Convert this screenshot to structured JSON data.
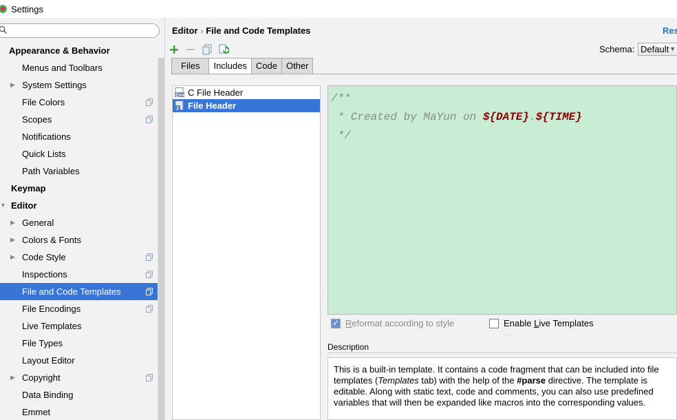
{
  "window": {
    "title": "Settings"
  },
  "search": {
    "value": "",
    "placeholder": ""
  },
  "sidebar": {
    "items": [
      {
        "label": "Appearance & Behavior",
        "level": 0,
        "bold": true,
        "arrow": "",
        "copy": false
      },
      {
        "label": "Menus and Toolbars",
        "level": 1,
        "bold": false,
        "arrow": "",
        "copy": false
      },
      {
        "label": "System Settings",
        "level": 1,
        "bold": false,
        "arrow": "right",
        "copy": false
      },
      {
        "label": "File Colors",
        "level": 1,
        "bold": false,
        "arrow": "",
        "copy": true
      },
      {
        "label": "Scopes",
        "level": 1,
        "bold": false,
        "arrow": "",
        "copy": true
      },
      {
        "label": "Notifications",
        "level": 1,
        "bold": false,
        "arrow": "",
        "copy": false
      },
      {
        "label": "Quick Lists",
        "level": 1,
        "bold": false,
        "arrow": "",
        "copy": false
      },
      {
        "label": "Path Variables",
        "level": 1,
        "bold": false,
        "arrow": "",
        "copy": false
      },
      {
        "label": "Keymap",
        "level": 0,
        "bold": true,
        "arrow": "",
        "copy": false
      },
      {
        "label": "Editor",
        "level": 0,
        "bold": true,
        "arrow": "down",
        "copy": false
      },
      {
        "label": "General",
        "level": 1,
        "bold": false,
        "arrow": "right",
        "copy": false
      },
      {
        "label": "Colors & Fonts",
        "level": 1,
        "bold": false,
        "arrow": "right",
        "copy": false
      },
      {
        "label": "Code Style",
        "level": 1,
        "bold": false,
        "arrow": "right",
        "copy": true
      },
      {
        "label": "Inspections",
        "level": 1,
        "bold": false,
        "arrow": "",
        "copy": true
      },
      {
        "label": "File and Code Templates",
        "level": 1,
        "bold": false,
        "arrow": "",
        "copy": true,
        "selected": true
      },
      {
        "label": "File Encodings",
        "level": 1,
        "bold": false,
        "arrow": "",
        "copy": true
      },
      {
        "label": "Live Templates",
        "level": 1,
        "bold": false,
        "arrow": "",
        "copy": false
      },
      {
        "label": "File Types",
        "level": 1,
        "bold": false,
        "arrow": "",
        "copy": false
      },
      {
        "label": "Layout Editor",
        "level": 1,
        "bold": false,
        "arrow": "",
        "copy": false
      },
      {
        "label": "Copyright",
        "level": 1,
        "bold": false,
        "arrow": "right",
        "copy": true
      },
      {
        "label": "Data Binding",
        "level": 1,
        "bold": false,
        "arrow": "",
        "copy": false
      },
      {
        "label": "Emmet",
        "level": 1,
        "bold": false,
        "arrow": "",
        "copy": false
      }
    ]
  },
  "breadcrumb": {
    "parent": "Editor",
    "separator": "›",
    "current": "File and Code Templates"
  },
  "reset_label": "Res",
  "schema": {
    "label": "Schema:",
    "value": "Default"
  },
  "tabs": [
    {
      "label": "Files",
      "active": false
    },
    {
      "label": "Includes",
      "active": true
    },
    {
      "label": "Code",
      "active": false
    },
    {
      "label": "Other",
      "active": false
    }
  ],
  "templates": [
    {
      "label": "C File Header",
      "icon": "c-file-icon",
      "selected": false
    },
    {
      "label": "File Header",
      "icon": "java-file-icon",
      "selected": true
    }
  ],
  "editor": {
    "line1": "/**",
    "line2_prefix": " * Created by MaYun on ",
    "var_date": "${DATE}",
    "dot": ".",
    "var_time": "${TIME}",
    "line3": " */"
  },
  "options": {
    "reformat": {
      "label_pre": "",
      "label_u": "R",
      "label_post": "eformat according to style",
      "checked": true,
      "enabled": false
    },
    "live": {
      "label_pre": "Enable ",
      "label_u": "L",
      "label_post": "ive Templates",
      "checked": false,
      "enabled": true
    }
  },
  "description": {
    "label": "Description",
    "text_1": "This is a built-in template. It contains a code fragment that can be included into file templates (",
    "text_templates": "Templates",
    "text_2": " tab) with the help of the ",
    "text_parse": "#parse",
    "text_3": " directive. The template is editable. Along with static text, code and comments, you can also use predefined variables that will then be expanded like macros into the corresponding values."
  },
  "colors": {
    "accent": "#3875d7",
    "editor_bg": "#c9ecd4",
    "var_color": "#8b0000",
    "link": "#2a6fb8"
  }
}
